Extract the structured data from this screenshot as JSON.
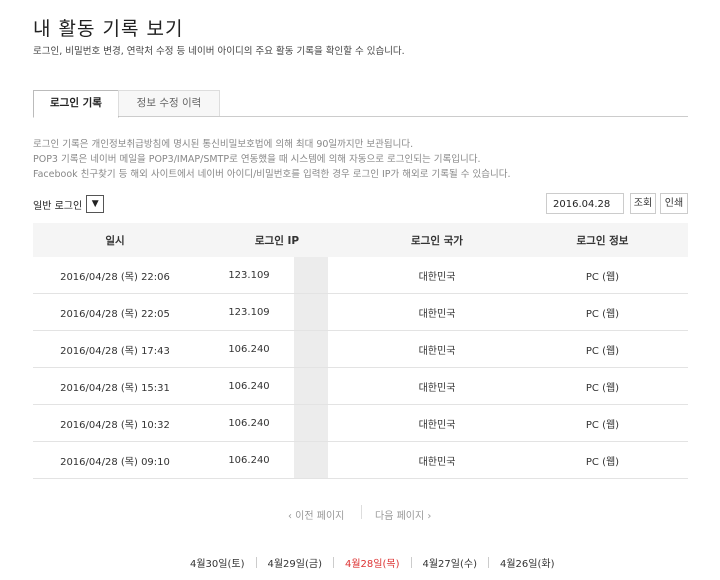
{
  "page": {
    "title": "내 활동 기록 보기",
    "subtitle": "로그인, 비밀번호 변경, 연락처 수정 등 네이버 아이디의 주요 활동 기록을 확인할 수 있습니다."
  },
  "tabs": [
    {
      "label": "로그인 기록",
      "active": true
    },
    {
      "label": "정보 수정 이력",
      "active": false
    }
  ],
  "notices": [
    "로그인 기록은 개인정보취급방침에 명시된 통신비밀보호법에 의해 최대 90일까지만 보관됩니다.",
    "POP3 기록은 네이버 메일을 POP3/IMAP/SMTP로 연동했을 때 시스템에 의해 자동으로 로그인되는 기록입니다.",
    "Facebook 친구찾기 등 해외 사이트에서 네이버 아이디/비밀번호를 입력한 경우 로그인 IP가 해외로 기록될 수 있습니다."
  ],
  "filter": {
    "selected": "일반 로그인",
    "icon": "chevron-down-icon"
  },
  "date_value": "2016.04.28",
  "buttons": {
    "lookup": "조회",
    "print": "인쇄"
  },
  "table": {
    "headers": [
      "일시",
      "로그인 IP",
      "로그인 국가",
      "로그인 정보"
    ],
    "rows": [
      {
        "datetime": "2016/04/28 (목) 22:06",
        "ip": "123.109",
        "country": "대한민국",
        "info": "PC (웹)"
      },
      {
        "datetime": "2016/04/28 (목) 22:05",
        "ip": "123.109",
        "country": "대한민국",
        "info": "PC (웹)"
      },
      {
        "datetime": "2016/04/28 (목) 17:43",
        "ip": "106.240",
        "country": "대한민국",
        "info": "PC (웹)"
      },
      {
        "datetime": "2016/04/28 (목) 15:31",
        "ip": "106.240",
        "country": "대한민국",
        "info": "PC (웹)"
      },
      {
        "datetime": "2016/04/28 (목) 10:32",
        "ip": "106.240",
        "country": "대한민국",
        "info": "PC (웹)"
      },
      {
        "datetime": "2016/04/28 (목) 09:10",
        "ip": "106.240",
        "country": "대한민국",
        "info": "PC (웹)"
      }
    ]
  },
  "pagination": {
    "prev": "‹ 이전 페이지",
    "next": "다음 페이지 ›"
  },
  "days": [
    {
      "label": "4월30일(토)",
      "active": false
    },
    {
      "label": "4월29일(금)",
      "active": false
    },
    {
      "label": "4월28일(목)",
      "active": true
    },
    {
      "label": "4월27일(수)",
      "active": false
    },
    {
      "label": "4월26일(화)",
      "active": false
    }
  ],
  "colors": {
    "accent_day": "#dd3333"
  }
}
